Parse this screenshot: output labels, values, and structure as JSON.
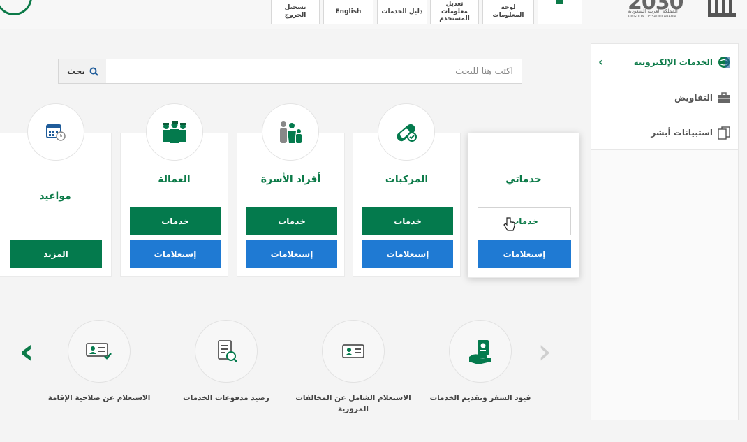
{
  "topbar": {
    "logout": "تسجيل الخروج",
    "english": "English",
    "services_guide": "دليل الخدمات",
    "edit_user_info": "تعديل معلومات المستخدم",
    "dashboard": "لوحة المعلومات",
    "vision_number": "2030",
    "vision_ar": "المملكة العربية السعودية",
    "vision_en": "KINGDOM OF SAUDI ARABIA"
  },
  "search": {
    "placeholder": "اكتب هنا للبحث",
    "button": "بحث"
  },
  "sidebar": {
    "items": [
      {
        "label": "الخدمات الإلكترونية",
        "icon": "globe-icon"
      },
      {
        "label": "التفاويض",
        "icon": "briefcase-icon"
      },
      {
        "label": "استبيانات أبشر",
        "icon": "documents-icon"
      }
    ]
  },
  "cards": [
    {
      "title": "خدماتي",
      "services": "خدمات",
      "inquiries": "إستعلامات"
    },
    {
      "title": "المركبات",
      "services": "خدمات",
      "inquiries": "إستعلامات",
      "icon": "vehicle-icon"
    },
    {
      "title": "أفراد الأسرة",
      "services": "خدمات",
      "inquiries": "إستعلامات",
      "icon": "family-icon"
    },
    {
      "title": "العمالة",
      "services": "خدمات",
      "inquiries": "إستعلامات",
      "icon": "workers-icon"
    },
    {
      "title": "مواعيد",
      "more": "المزيد",
      "icon": "calendar-icon"
    }
  ],
  "carousel": [
    {
      "label": "قيود السفر وتقديم الخدمات",
      "icon": "passport-hand-icon"
    },
    {
      "label": "الاستعلام الشامل عن المخالفات المرورية",
      "icon": "id-card-icon"
    },
    {
      "label": "رصيد مدفوعات الخدمات",
      "icon": "invoice-icon"
    },
    {
      "label": "الاستعلام عن صلاحية الإقامة",
      "icon": "id-check-icon"
    }
  ],
  "colors": {
    "green": "#047a4d",
    "blue": "#1f7ad3",
    "background": "#f4f4f4"
  }
}
